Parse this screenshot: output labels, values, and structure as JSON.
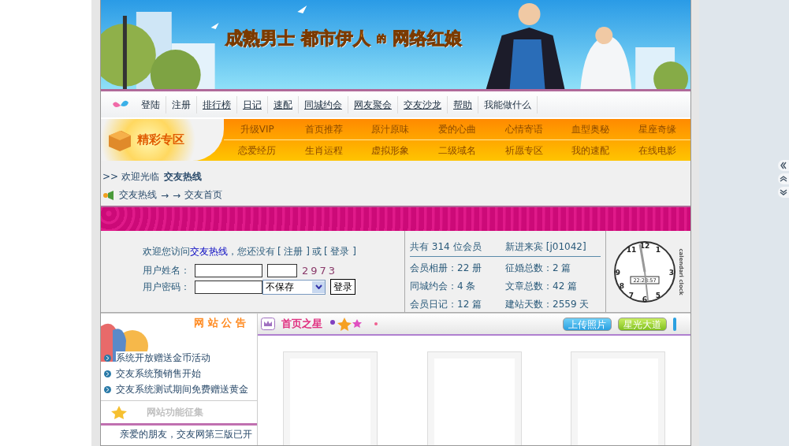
{
  "banner": {
    "headline": [
      "成熟男士",
      "都市伊人",
      "的",
      "网络红娘"
    ]
  },
  "nav": [
    {
      "label": "登陆",
      "link": false
    },
    {
      "label": "注册",
      "link": false
    },
    {
      "label": "排行榜",
      "link": true
    },
    {
      "label": "日记",
      "link": true
    },
    {
      "label": "速配",
      "link": true
    },
    {
      "label": "同城约会",
      "link": true
    },
    {
      "label": "网友聚会",
      "link": true
    },
    {
      "label": "交友沙龙",
      "link": true
    },
    {
      "label": "帮助",
      "link": true
    },
    {
      "label": "我能做什么",
      "link": false
    }
  ],
  "zone": {
    "title": "精彩专区",
    "rows": [
      [
        "升级VIP",
        "首页推荐",
        "原汁原味",
        "爱的心曲",
        "心情寄语",
        "血型奥秘",
        "星座奇缘"
      ],
      [
        "恋爱经历",
        "生肖运程",
        "虚拟形象",
        "二级域名",
        "祈愿专区",
        "我的速配",
        "在线电影"
      ]
    ]
  },
  "welcome": {
    "marker": ">>",
    "text": "欢迎光临",
    "site": "交友热线"
  },
  "breadcrumb": [
    "交友热线",
    "→",
    "→",
    "交友首页"
  ],
  "login": {
    "intro": "欢迎您访问",
    "site": "交友热线",
    "middle": "，您还没有",
    "register": "[ 注册 ]",
    "or": "或",
    "login": "[ 登录 ]",
    "user_label": "用户姓名：",
    "pass_label": "用户密码：",
    "captcha": "2973",
    "remember": "不保存",
    "submit": "登录"
  },
  "stats": {
    "total": "共有 314 位会员",
    "newest": "新进来宾 [j01042]",
    "items": [
      "会员相册：22 册",
      "征婚总数：2 篇",
      "同城约会：4 条",
      "文章总数：42 篇",
      "会员日记：12 篇",
      "建站天数：2559 天"
    ]
  },
  "clock": {
    "numerals": [
      "12",
      "1",
      "3",
      "5",
      "6",
      "7",
      "8",
      "9",
      "11"
    ],
    "time": "22:28:57",
    "brand": "calendari clock"
  },
  "notice": {
    "title": "网 站 公 告",
    "items": [
      "系统开放赠送金币活动",
      "交友系统预销售开始",
      "交友系统测试期间免费赠送黄金"
    ]
  },
  "feature": {
    "title": "网站功能征集",
    "text": "亲爱的朋友，交友网第三版已开"
  },
  "stars": {
    "title": "首页之星",
    "buttons": [
      "上传照片",
      "星光大道"
    ]
  }
}
